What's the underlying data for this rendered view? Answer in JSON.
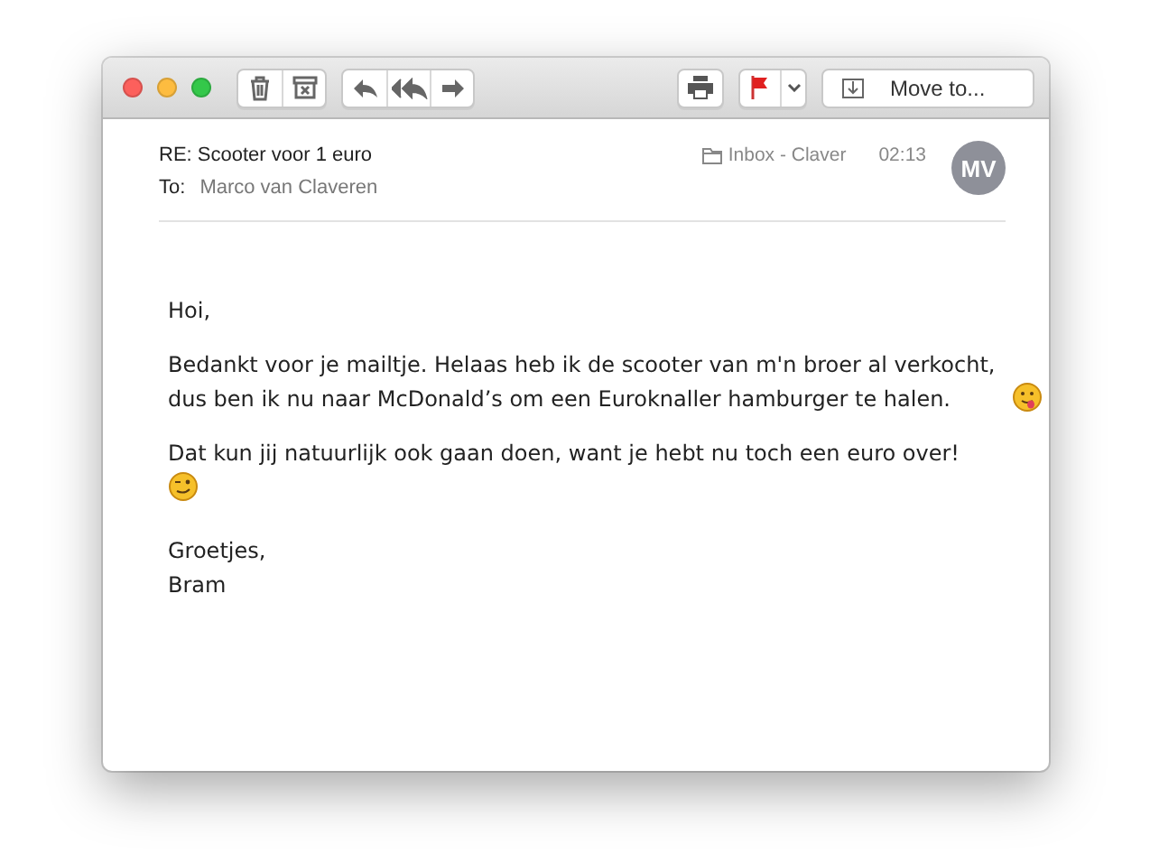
{
  "toolbar": {
    "groups": [
      {
        "buttons": [
          {
            "kind": "trash"
          },
          {
            "kind": "archive"
          }
        ]
      },
      {
        "buttons": [
          {
            "kind": "reply"
          },
          {
            "kind": "reply-all"
          },
          {
            "kind": "forward"
          }
        ]
      },
      {
        "buttons": [
          {
            "kind": "print"
          }
        ]
      },
      {
        "buttons": [
          {
            "kind": "flag"
          },
          {
            "kind": "caret"
          }
        ]
      }
    ],
    "move_to": "Move to..."
  },
  "header": {
    "subject": "RE: Scooter voor 1 euro",
    "to_label": "To:",
    "recipient": "Marco van Claveren",
    "mailbox": "Inbox - Claver",
    "time": "02:13",
    "avatar": "MV"
  },
  "body": [
    {
      "text": "Hoi,",
      "kind": "plain"
    },
    {
      "text": "Bedankt voor je mailtje. Helaas heb ik de scooter van m'n broer al verkocht, dus ben ik nu naar McDonald’s om een Euroknaller hamburger te halen.",
      "kind": "tongue"
    },
    {
      "text": "Dat kun jij natuurlijk ook gaan doen, want je hebt nu toch een euro over!",
      "kind": "wink"
    }
  ],
  "signoff": {
    "closing": "Groetjes,",
    "name": "Bram"
  }
}
